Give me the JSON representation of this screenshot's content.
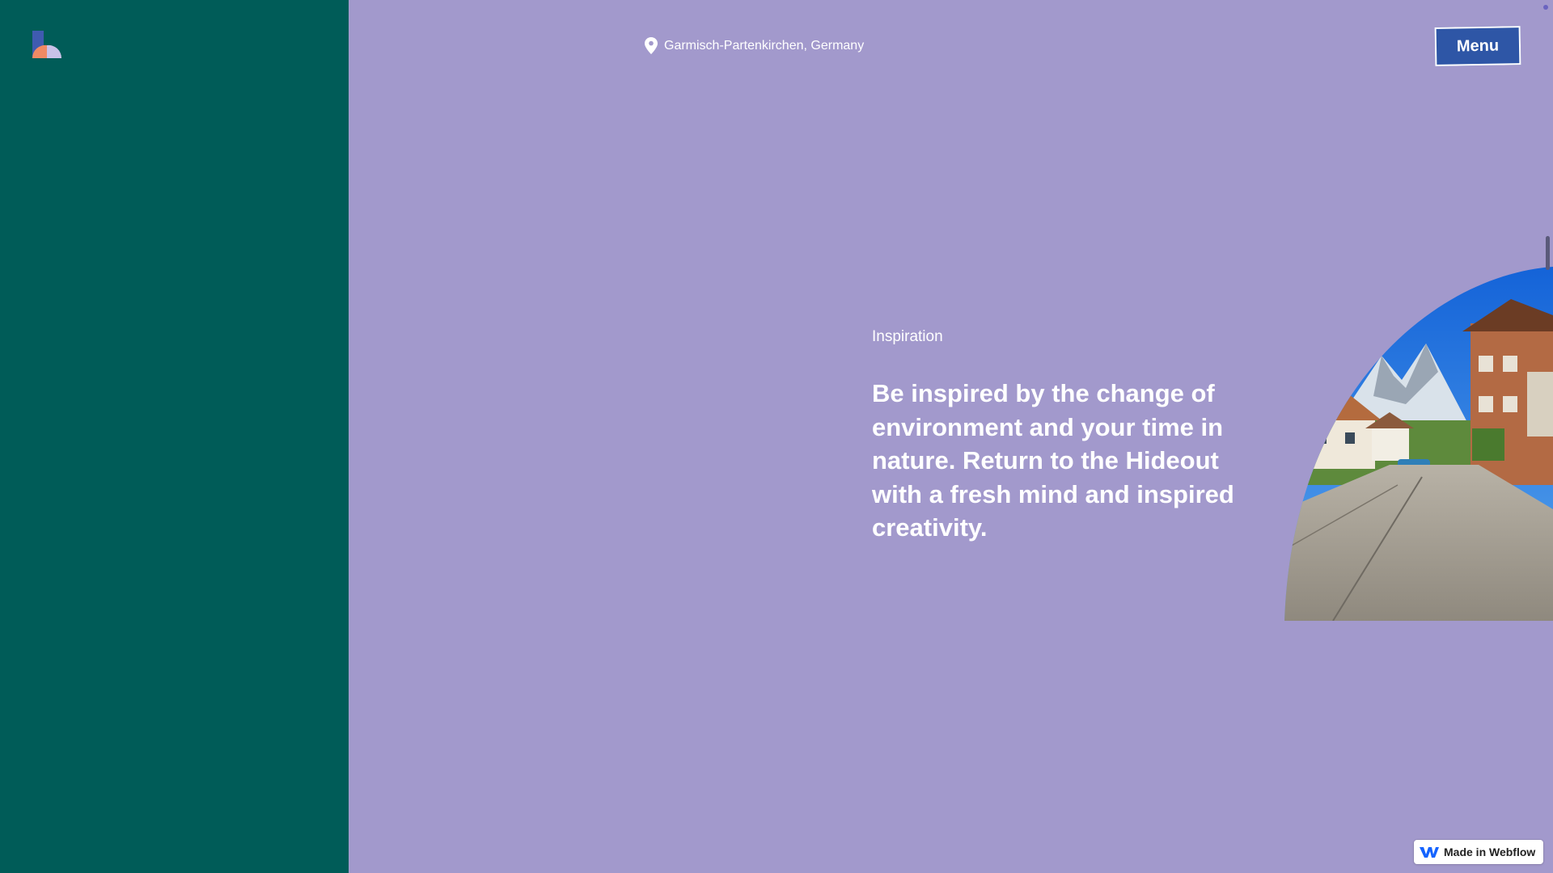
{
  "header": {
    "logo": "hideout-logo",
    "location": {
      "icon": "map-pin-icon",
      "text": "Garmisch-Partenkirchen, Germany"
    },
    "menu_label": "Menu"
  },
  "section": {
    "eyebrow": "Inspiration",
    "headline": "Be inspired by the change of environment and your time in nature. Return to the Hideout with a fresh mind and inspired creativity.",
    "image": "alpine-village-street-photo"
  },
  "badge": {
    "icon": "webflow-icon",
    "label": "Made in Webflow"
  },
  "colors": {
    "side_panel": "#005c58",
    "background": "#a299cc",
    "menu_button": "#2e56a6",
    "text": "#ffffff"
  }
}
